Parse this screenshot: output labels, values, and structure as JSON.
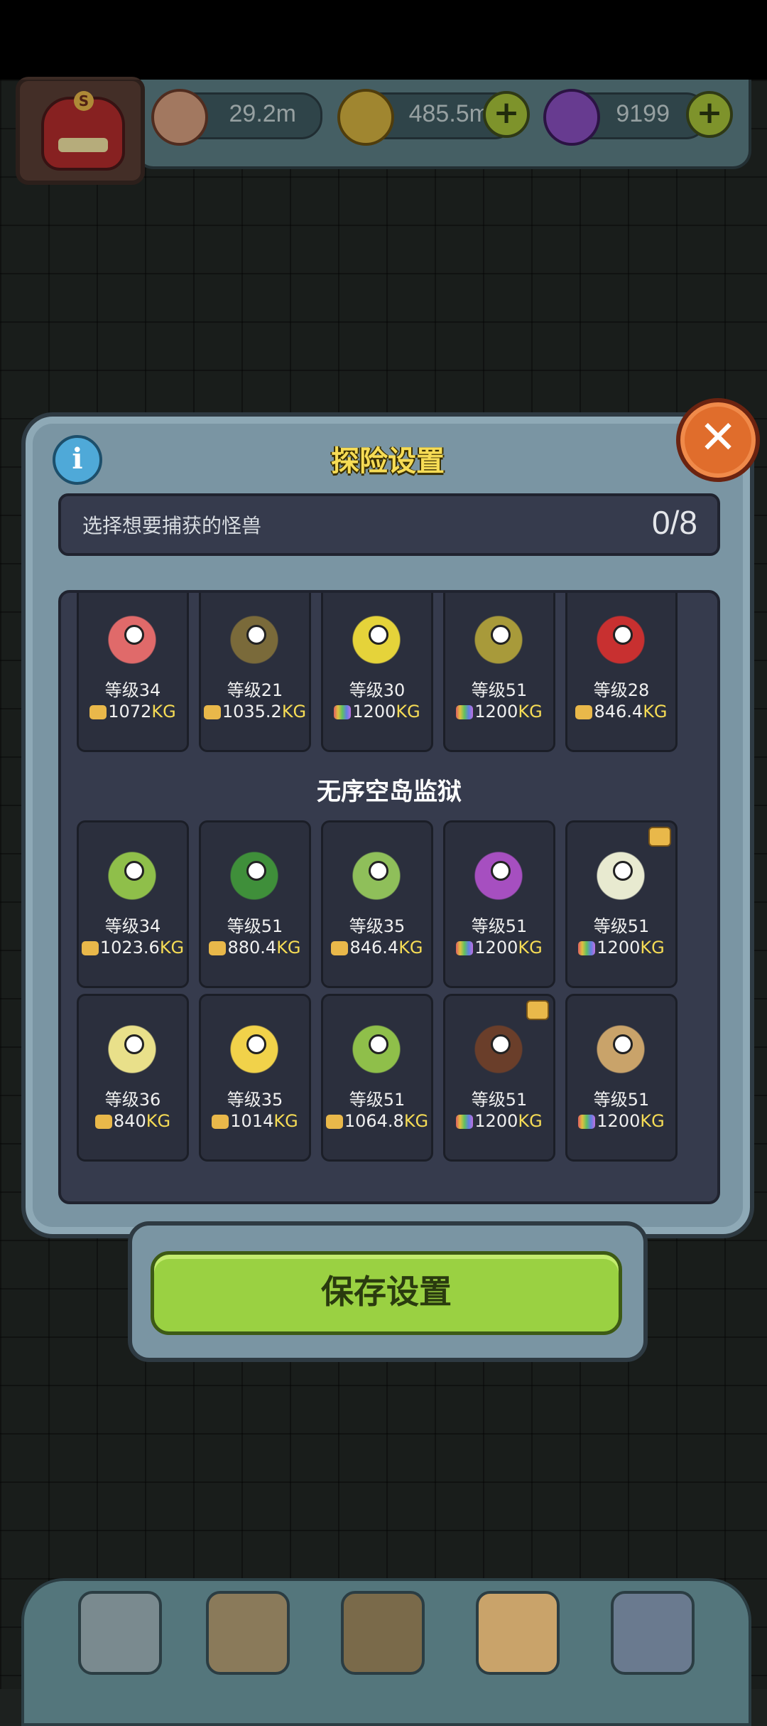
{
  "resources": [
    {
      "name": "eyeball",
      "value": "29.2m",
      "icon": "eyeball-icon",
      "color": "#d8a080"
    },
    {
      "name": "coin",
      "value": "485.5m",
      "icon": "coin-icon",
      "color": "#d6b340"
    },
    {
      "name": "potion",
      "value": "9199",
      "icon": "potion-icon",
      "color": "#8a4fc0"
    }
  ],
  "dialog": {
    "title": "探险设置",
    "subtitle": "选择想要捕获的怪兽",
    "count": "0/8",
    "section_title": "无序空岛监狱",
    "save_label": "保存设置"
  },
  "kg_label": "KG",
  "monsters_row1": [
    {
      "level": "等级34",
      "weight": "1072",
      "kg_type": "gold",
      "icon": "peach-monster-icon",
      "color": "#e06a6a"
    },
    {
      "level": "等级21",
      "weight": "1035.2",
      "kg_type": "gold",
      "icon": "kiwi-crab-monster-icon",
      "color": "#7a6a3a"
    },
    {
      "level": "等级30",
      "weight": "1200",
      "kg_type": "rainbow",
      "icon": "pear-monster-icon",
      "color": "#e5d33a"
    },
    {
      "level": "等级51",
      "weight": "1200",
      "kg_type": "rainbow",
      "icon": "cowboy-monster-icon",
      "color": "#a89a3a"
    },
    {
      "level": "等级28",
      "weight": "846.4",
      "kg_type": "gold",
      "icon": "lips-monster-icon",
      "color": "#c83030"
    }
  ],
  "monsters_row2": [
    {
      "level": "等级34",
      "weight": "1023.6",
      "kg_type": "gold",
      "icon": "cabbage-turtle-icon",
      "color": "#8fbf4a",
      "badge": false
    },
    {
      "level": "等级51",
      "weight": "880.4",
      "kg_type": "gold",
      "icon": "watermelon-monster-icon",
      "color": "#3f8f3a",
      "badge": false
    },
    {
      "level": "等级35",
      "weight": "846.4",
      "kg_type": "gold",
      "icon": "twig-monster-icon",
      "color": "#8fbf5a",
      "badge": false
    },
    {
      "level": "等级51",
      "weight": "1200",
      "kg_type": "rainbow",
      "icon": "grape-monster-icon",
      "color": "#a64fc0",
      "badge": false
    },
    {
      "level": "等级51",
      "weight": "1200",
      "kg_type": "rainbow",
      "icon": "radish-monster-icon",
      "color": "#e8ead0",
      "badge": true
    }
  ],
  "monsters_row3": [
    {
      "level": "等级36",
      "weight": "840",
      "kg_type": "gold",
      "icon": "cauliflower-monster-icon",
      "color": "#e9e08a",
      "badge": false
    },
    {
      "level": "等级35",
      "weight": "1014",
      "kg_type": "gold",
      "icon": "cheese-monster-icon",
      "color": "#f1d24a",
      "badge": false
    },
    {
      "level": "等级51",
      "weight": "1064.8",
      "kg_type": "gold",
      "icon": "medusa-plant-icon",
      "color": "#8fbf4a",
      "badge": false
    },
    {
      "level": "等级51",
      "weight": "1200",
      "kg_type": "rainbow",
      "icon": "hairy-monster-icon",
      "color": "#6a3e2a",
      "badge": true
    },
    {
      "level": "等级51",
      "weight": "1200",
      "kg_type": "rainbow",
      "icon": "onion-monster-icon",
      "color": "#c9a36a",
      "badge": false
    }
  ],
  "colors": {
    "kg_gold": "#e9b84a",
    "kg_rainbow": "#c070e0",
    "title_yellow": "#f6dc55",
    "save_green": "#9ad142"
  },
  "bottom_nav": [
    {
      "icon": "shop-icon",
      "color": "#7a8a8f"
    },
    {
      "icon": "dungeon-icon",
      "color": "#8a7a5a"
    },
    {
      "icon": "book-icon",
      "color": "#7a6a4a"
    },
    {
      "icon": "money-bag-icon",
      "color": "#c9a36a"
    },
    {
      "icon": "grid-menu-icon",
      "color": "#6a7a8f"
    }
  ]
}
